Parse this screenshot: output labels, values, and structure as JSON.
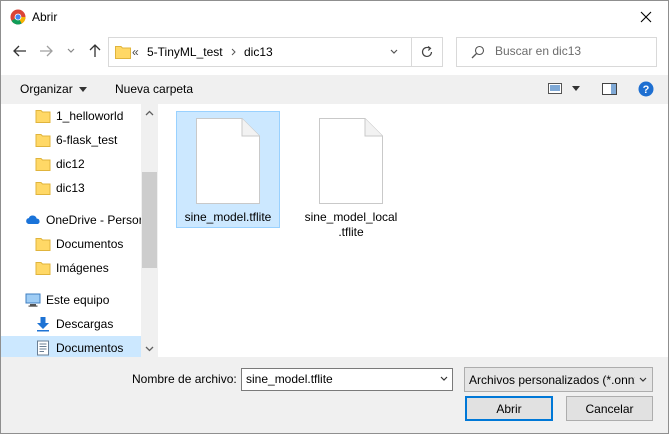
{
  "window": {
    "title": "Abrir"
  },
  "address": {
    "overflow": "«",
    "crumbs": [
      "5-TinyML_test",
      "dic13"
    ]
  },
  "search": {
    "placeholder": "Buscar en dic13"
  },
  "toolbar": {
    "organize": "Organizar",
    "new_folder": "Nueva carpeta"
  },
  "nav": {
    "items": [
      {
        "label": "1_helloworld",
        "icon": "folder-icon"
      },
      {
        "label": "6-flask_test",
        "icon": "folder-icon"
      },
      {
        "label": "dic12",
        "icon": "folder-icon"
      },
      {
        "label": "dic13",
        "icon": "folder-icon"
      },
      {
        "label": "OneDrive - Persor",
        "icon": "onedrive-icon"
      },
      {
        "label": "Documentos",
        "icon": "folder-icon"
      },
      {
        "label": "Imágenes",
        "icon": "folder-icon"
      },
      {
        "label": "Este equipo",
        "icon": "computer-icon"
      },
      {
        "label": "Descargas",
        "icon": "download-icon"
      },
      {
        "label": "Documentos",
        "icon": "documents-icon"
      }
    ]
  },
  "files": [
    {
      "name": "sine_model.tflite",
      "name2": "",
      "selected": true
    },
    {
      "name": "sine_model_local",
      "name2": ".tflite",
      "selected": false
    }
  ],
  "footer": {
    "filename_label": "Nombre de archivo:",
    "filename_value": "sine_model.tflite",
    "filetype": "Archivos personalizados (*.onnx",
    "open": "Abrir",
    "cancel": "Cancelar"
  },
  "colors": {
    "selection": "#cce8ff",
    "accent": "#0078d7",
    "folder": "#ffd866"
  }
}
